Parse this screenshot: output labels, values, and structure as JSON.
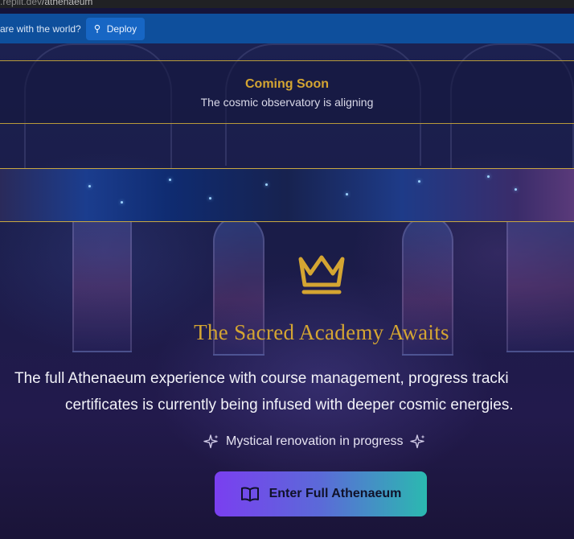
{
  "browser": {
    "url_host": ".replit.dev",
    "url_path": "/athenaeum"
  },
  "banner": {
    "prompt": "are with the world?",
    "deploy_label": "Deploy"
  },
  "coming_soon": {
    "title": "Coming Soon",
    "subtitle": "The cosmic observatory is aligning"
  },
  "main": {
    "heading": "The Sacred Academy Awaits",
    "description_line1": "The full Athenaeum experience with course management, progress tracki",
    "description_line2": "certificates is currently being infused with deeper cosmic energies.",
    "progress_text": "Mystical renovation in progress",
    "enter_button_label": "Enter Full Athenaeum"
  },
  "colors": {
    "gold": "#d4a532",
    "banner_blue": "#0e4f9c",
    "button_gradient_start": "#7a3ff0",
    "button_gradient_end": "#2bb9b0"
  },
  "icons": {
    "crown": "crown-icon",
    "sparkle": "sparkle-icon",
    "book": "book-open-icon",
    "deploy": "deploy-icon"
  }
}
